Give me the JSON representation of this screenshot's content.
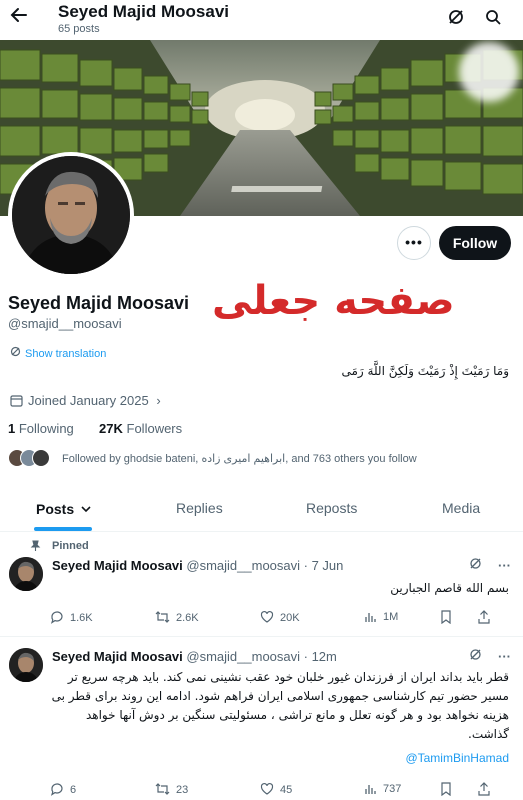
{
  "header": {
    "name": "Seyed Majid Moosavi",
    "posts_count": "65 posts"
  },
  "profile": {
    "name": "Seyed Majid Moosavi",
    "handle": "@smajid__moosavi",
    "overlay_text": "صفحه جعلی",
    "show_translation": "Show translation",
    "bio": "وَمَا رَمَيْتَ إِذْ رَمَيْتَ وَلَكِنَّ اللَّهَ رَمَى",
    "joined": "Joined January 2025",
    "following_count": "1",
    "following_label": "Following",
    "followers_count": "27K",
    "followers_label": "Followers",
    "followed_by": "Followed by ghodsie bateni, ابراهیم امیری زاده, and 763 others you follow",
    "follow_label": "Follow",
    "more_label": "•••"
  },
  "tabs": [
    {
      "label": "Posts",
      "active": true
    },
    {
      "label": "Replies",
      "active": false
    },
    {
      "label": "Reposts",
      "active": false
    },
    {
      "label": "Media",
      "active": false
    }
  ],
  "tweets": [
    {
      "pinned_label": "Pinned",
      "name": "Seyed Majid Moosavi",
      "meta": "@smajid__moosavi · 7 Jun",
      "text": "بسم الله قاصم الجبارین",
      "replies": "1.6K",
      "reposts": "2.6K",
      "likes": "20K",
      "views": "1M"
    },
    {
      "name": "Seyed Majid Moosavi",
      "meta": "@smajid__moosavi · 12m",
      "lines": [
        "قطر باید بداند ایران از فرزندان غیور خلبان خود عقب نشینی نمی کند. باید هرچه سریع تر",
        "مسیر حضور تیم کارشناسی جمهوری اسلامی ایران فراهم شود. ادامه این روند برای قطر بی",
        "هزینه نخواهد بود و هر گونه تعلل و مانع تراشی ، مسئولیتی سنگین بر دوش آنها خواهد",
        "گذاشت."
      ],
      "link": "@TamimBinHamad",
      "replies": "6",
      "reposts": "23",
      "likes": "45",
      "views": "737"
    }
  ],
  "colors": {
    "accent": "#1d9bf0",
    "stamp": "#d42a2a",
    "text": "#0f1419",
    "muted": "#536471"
  }
}
